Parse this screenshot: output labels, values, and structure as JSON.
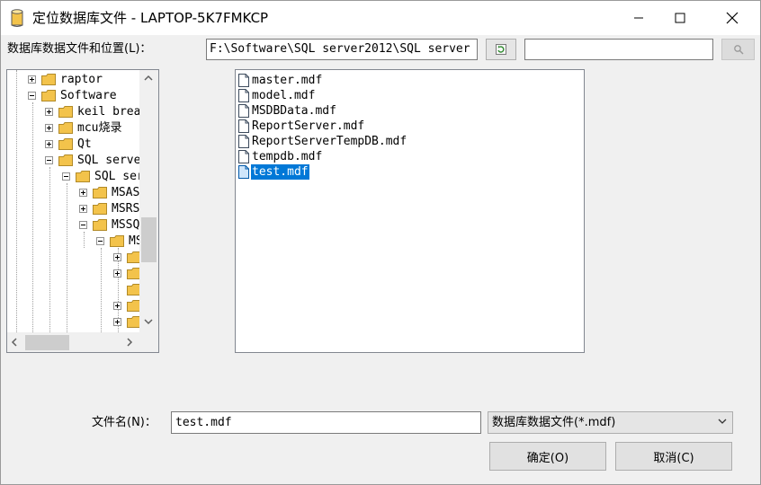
{
  "window": {
    "title": "定位数据库文件 - LAPTOP-5K7FMKCP",
    "icon": "database-cylinder-icon",
    "controls": [
      "minimize-icon",
      "maximize-icon",
      "close-icon"
    ]
  },
  "location": {
    "label": "数据库数据文件和位置(L)：",
    "path": "F:\\Software\\SQL server2012\\SQL server",
    "refresh_icon": "refresh-icon",
    "search_value": "",
    "search_icon": "search-icon"
  },
  "tree": {
    "items": [
      {
        "label": "raptor",
        "expanded": false
      },
      {
        "label": "Software",
        "expanded": true
      },
      {
        "label": "keil brea",
        "expanded": false
      },
      {
        "label": "mcu烧录",
        "expanded": false
      },
      {
        "label": "Qt",
        "expanded": false
      },
      {
        "label": "SQL serve",
        "expanded": true
      },
      {
        "label": "SQL ser",
        "expanded": true
      },
      {
        "label": "MSAS",
        "expanded": false
      },
      {
        "label": "MSRS",
        "expanded": false
      },
      {
        "label": "MSSQ",
        "expanded": true
      },
      {
        "label": "MS",
        "expanded": true
      },
      {
        "label": "",
        "expanded": false
      },
      {
        "label": "",
        "expanded": false
      },
      {
        "label": "",
        "expanded": false
      },
      {
        "label": "",
        "expanded": false
      },
      {
        "label": "",
        "expanded": false
      }
    ]
  },
  "files": {
    "items": [
      "master.mdf",
      "model.mdf",
      "MSDBData.mdf",
      "ReportServer.mdf",
      "ReportServerTempDB.mdf",
      "tempdb.mdf",
      "test.mdf"
    ],
    "selected": "test.mdf"
  },
  "bottom": {
    "filename_label": "文件名(N)：",
    "filename_value": "test.mdf",
    "filter_value": "数据库数据文件(*.mdf)",
    "ok_label": "确定(O)",
    "cancel_label": "取消(C)"
  },
  "colors": {
    "selection": "#0078d7",
    "folder": "#f3c34b",
    "window_bg": "#f0f0f0"
  }
}
